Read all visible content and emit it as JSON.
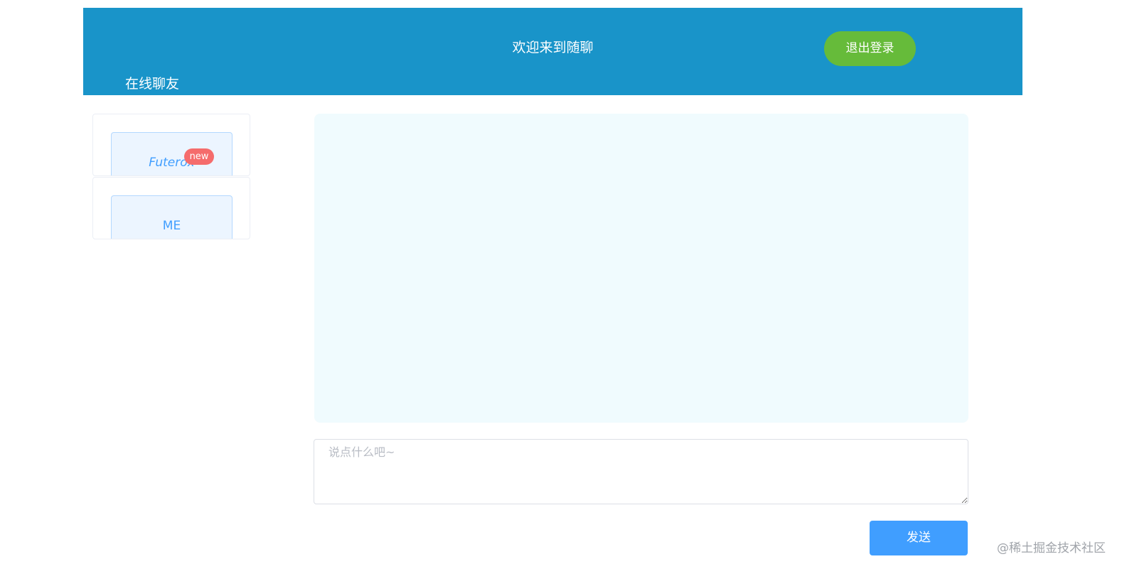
{
  "header": {
    "title": "欢迎来到随聊",
    "logout_label": "退出登录",
    "online_label": "在线聊友"
  },
  "friends": [
    {
      "name": "Futerox",
      "badge": "new"
    },
    {
      "name": "ME"
    }
  ],
  "input": {
    "placeholder": "说点什么吧~",
    "value": ""
  },
  "send_label": "发送",
  "watermark": "@稀土掘金技术社区",
  "colors": {
    "header_bg": "#1994c9",
    "logout_bg": "#66bb3a",
    "send_bg": "#409eff",
    "badge_bg": "#f56c6c",
    "chat_bg": "#f0fbfe"
  }
}
